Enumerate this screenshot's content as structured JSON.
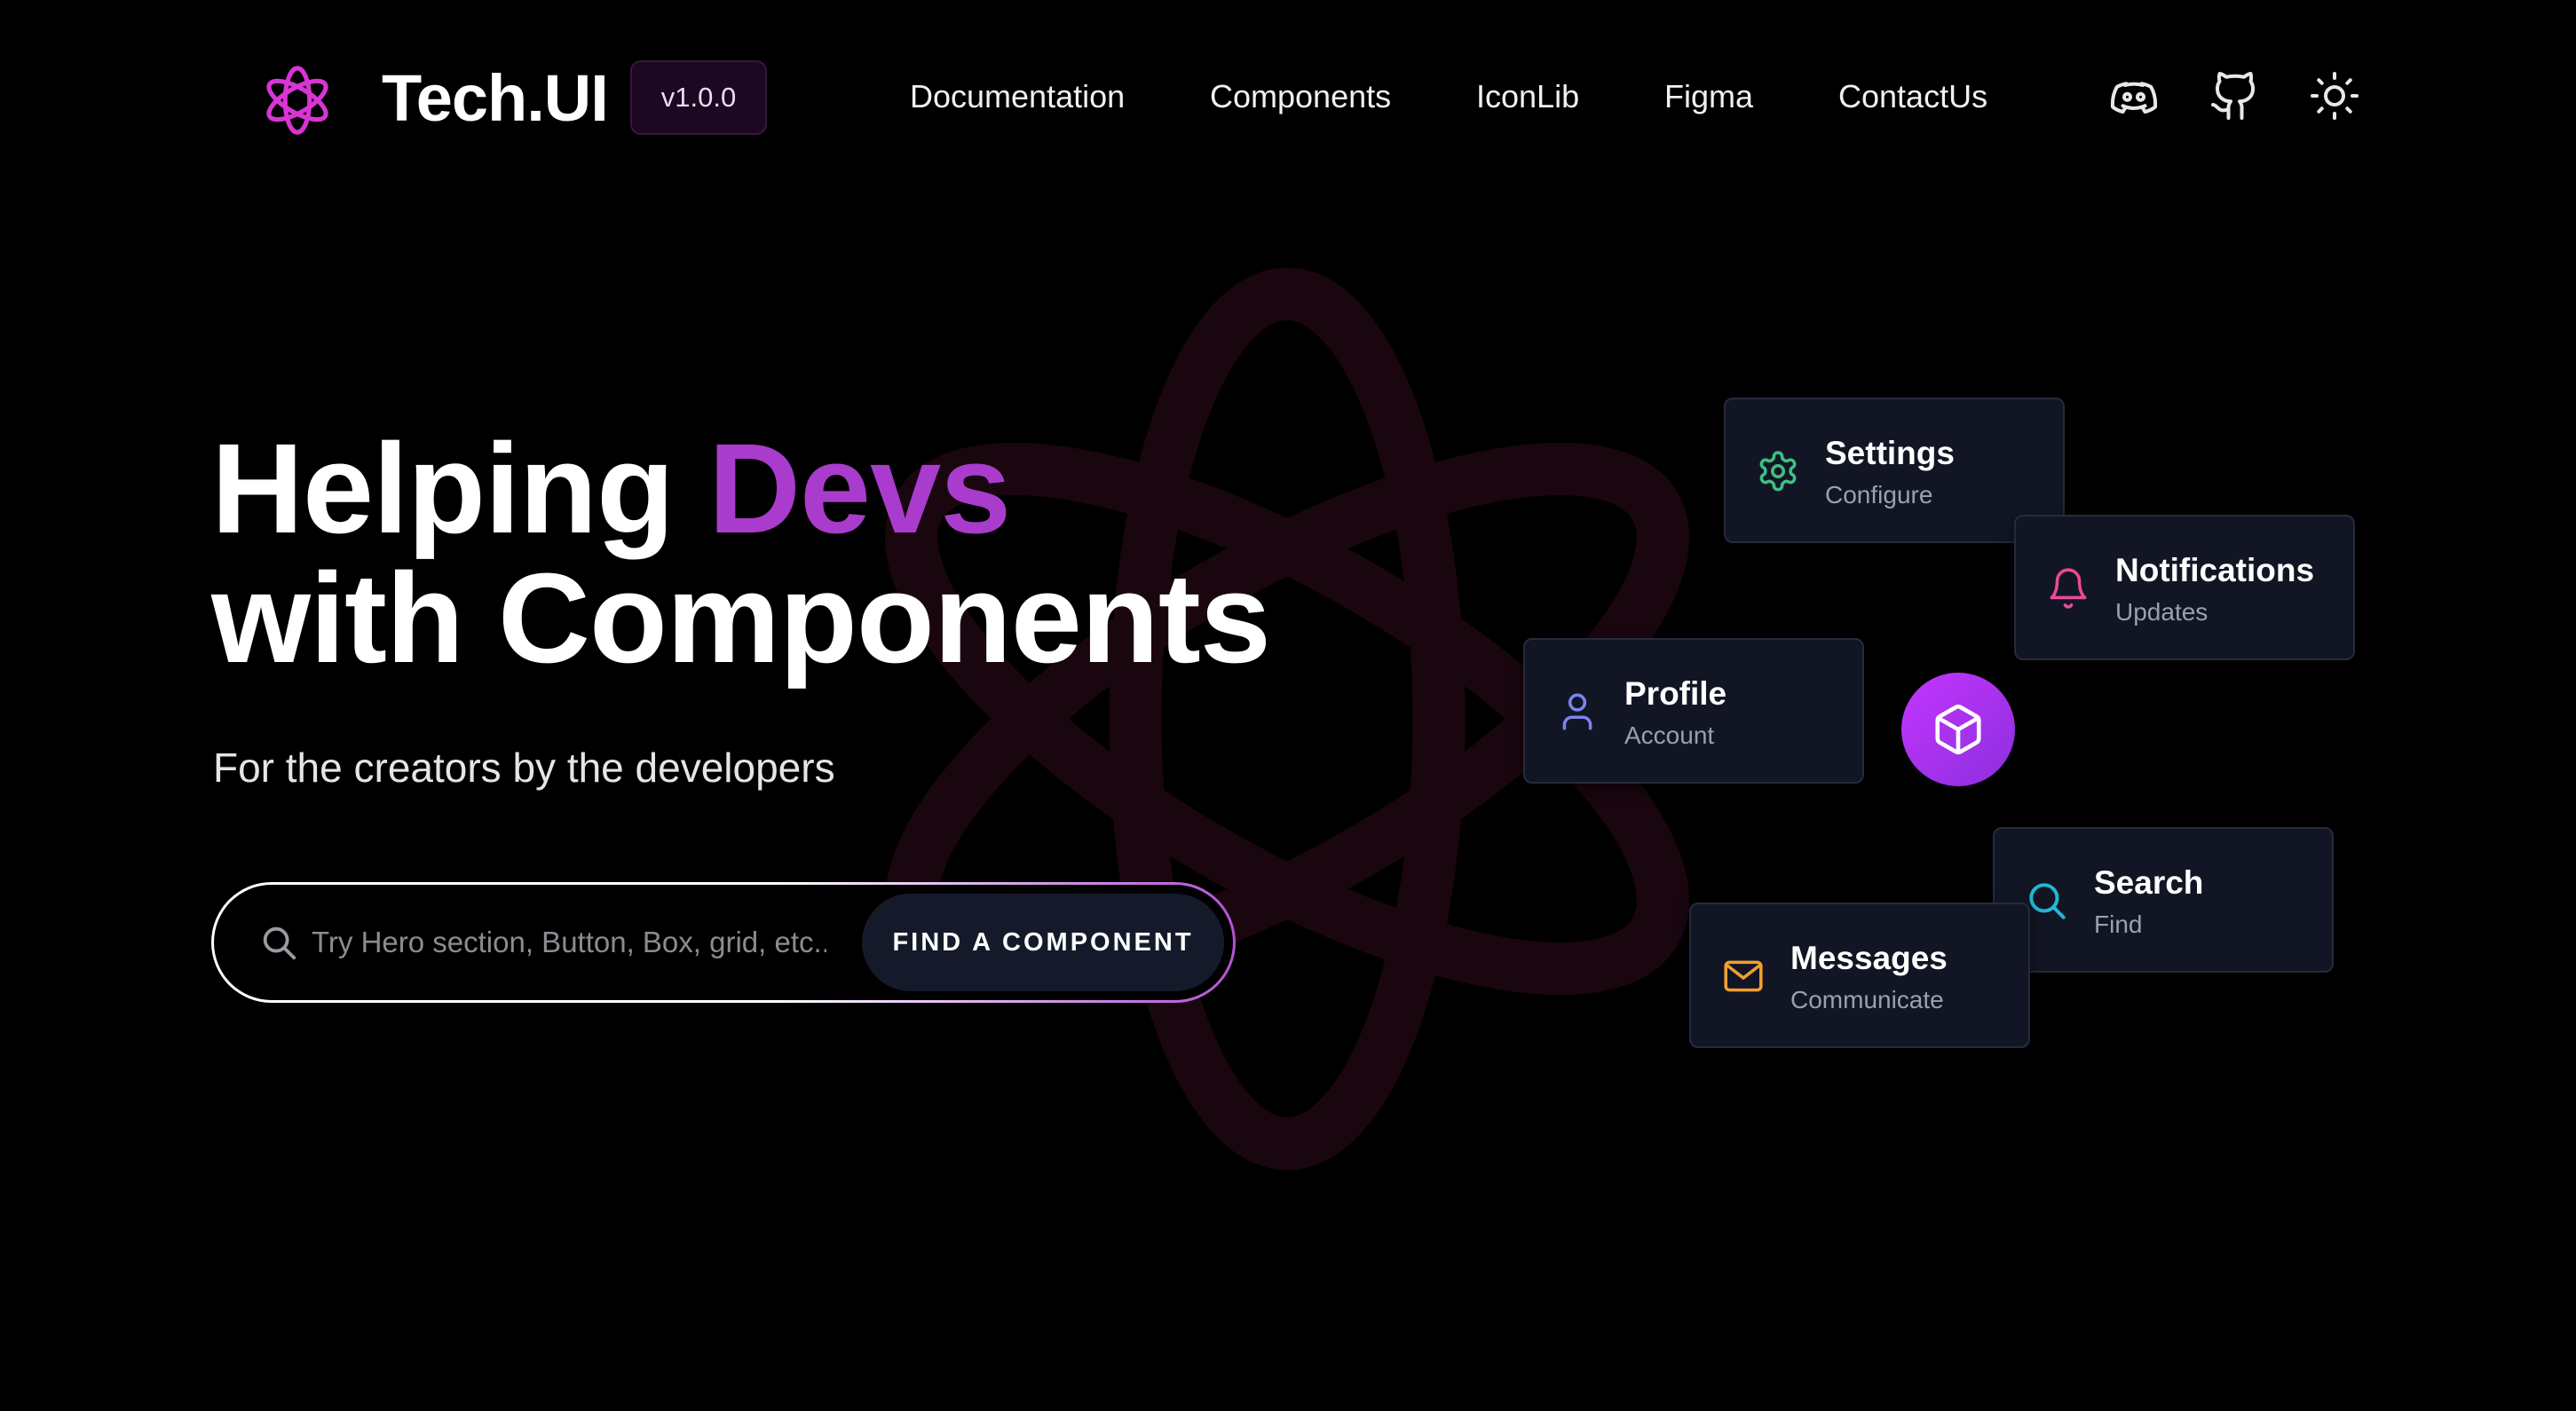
{
  "brand": {
    "name": "Tech.UI",
    "version": "v1.0.0"
  },
  "nav": {
    "items": [
      {
        "label": "Documentation"
      },
      {
        "label": "Components"
      },
      {
        "label": "IconLib"
      },
      {
        "label": "Figma"
      },
      {
        "label": "ContactUs"
      }
    ],
    "icons": [
      "discord-icon",
      "github-icon",
      "sun-icon"
    ]
  },
  "hero": {
    "title_part1": "Helping ",
    "title_accent": "Devs",
    "title_line2": "with Components",
    "subtitle": "For the creators by the developers"
  },
  "search": {
    "placeholder": "Try Hero section, Button, Box, grid, etc..",
    "value": "",
    "button_label": "FIND A COMPONENT"
  },
  "cards": [
    {
      "title": "Settings",
      "subtitle": "Configure",
      "icon": "gear-icon",
      "color": "#3fbf86"
    },
    {
      "title": "Notifications",
      "subtitle": "Updates",
      "icon": "bell-icon",
      "color": "#ec4899"
    },
    {
      "title": "Profile",
      "subtitle": "Account",
      "icon": "user-icon",
      "color": "#7c83f0"
    },
    {
      "title": "Search",
      "subtitle": "Find",
      "icon": "search-icon",
      "color": "#22b8d6"
    },
    {
      "title": "Messages",
      "subtitle": "Communicate",
      "icon": "mail-icon",
      "color": "#f0a030"
    }
  ],
  "center_icon": "cube-icon",
  "colors": {
    "accent": "#a93ccc",
    "background": "#000000",
    "card": "#121624",
    "watermark": "#1a060f"
  }
}
